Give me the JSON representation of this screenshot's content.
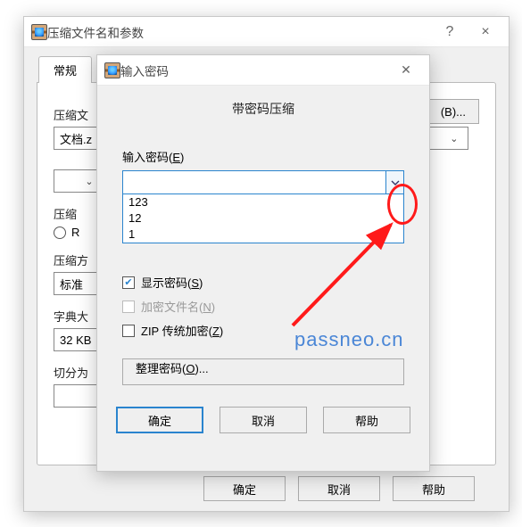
{
  "back_window": {
    "title": "压缩文件名和参数",
    "help_btn": "?",
    "close_btn": "×",
    "tabs": {
      "general": "常规"
    },
    "archive_name_label": "压缩文",
    "archive_name_value": "文档.z",
    "browse_btn": "(B)...",
    "format_label": "压缩",
    "format_radio_rar": "R",
    "method_label": "压缩方",
    "method_value": "标准",
    "dict_label": "字典大",
    "dict_value": "32 KB",
    "split_label": "切分为",
    "buttons": {
      "ok": "确定",
      "cancel": "取消",
      "help": "帮助"
    }
  },
  "dialog": {
    "title": "输入密码",
    "close_btn": "✕",
    "subtitle": "带密码压缩",
    "pw_label_pre": "输入密码(",
    "pw_label_u": "E",
    "pw_label_post": ")",
    "pw_value": "",
    "history": [
      "123",
      "12",
      "1"
    ],
    "show_pw_pre": "显示密码(",
    "show_pw_u": "S",
    "show_pw_post": ")",
    "show_pw_checked": true,
    "encrypt_names_pre": "加密文件名(",
    "encrypt_names_u": "N",
    "encrypt_names_post": ")",
    "zip_legacy_pre": "ZIP 传统加密(",
    "zip_legacy_u": "Z",
    "zip_legacy_post": ")",
    "organize_pre": "整理密码(",
    "organize_u": "O",
    "organize_post": ")...",
    "buttons": {
      "ok": "确定",
      "cancel": "取消",
      "help": "帮助"
    }
  },
  "watermark": "passneo.cn"
}
